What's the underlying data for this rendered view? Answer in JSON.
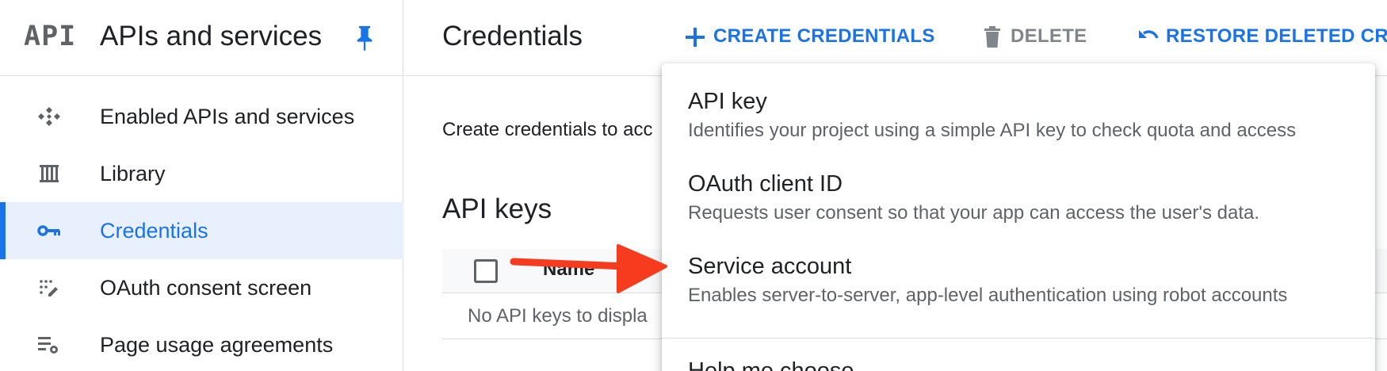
{
  "sidebar": {
    "logo": "API",
    "title": "APIs and services",
    "items": [
      {
        "label": "Enabled APIs and services",
        "icon": "enabled-apis-icon"
      },
      {
        "label": "Library",
        "icon": "library-icon"
      },
      {
        "label": "Credentials",
        "icon": "key-icon",
        "active": true
      },
      {
        "label": "OAuth consent screen",
        "icon": "consent-icon"
      },
      {
        "label": "Page usage agreements",
        "icon": "settings-list-icon"
      }
    ]
  },
  "header": {
    "title": "Credentials",
    "create_label": "CREATE CREDENTIALS",
    "delete_label": "DELETE",
    "restore_label": "RESTORE DELETED CRE"
  },
  "main": {
    "description": "Create credentials to acc",
    "section_title": "API keys",
    "table": {
      "columns": [
        "Name"
      ],
      "empty_text": "No API keys to displa"
    }
  },
  "menu": {
    "items": [
      {
        "title": "API key",
        "description": "Identifies your project using a simple API key to check quota and access"
      },
      {
        "title": "OAuth client ID",
        "description": "Requests user consent so that your app can access the user's data."
      },
      {
        "title": "Service account",
        "description": "Enables server-to-server, app-level authentication using robot accounts"
      }
    ],
    "partial_item": "Help me choose"
  },
  "colors": {
    "accent": "#1a73e8",
    "active_bg": "#e8f0fe",
    "annotation_arrow": "#f73b1e"
  }
}
